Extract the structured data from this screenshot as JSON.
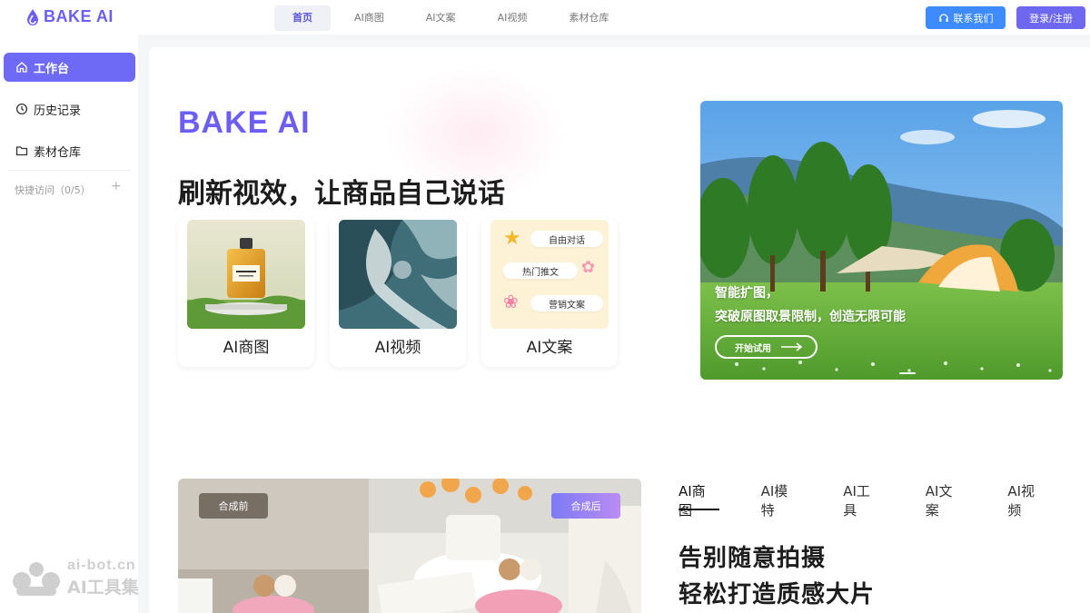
{
  "header": {
    "logo_text": "BAKE AI",
    "nav": [
      {
        "label": "首页",
        "active": true
      },
      {
        "label": "AI商图",
        "active": false
      },
      {
        "label": "AI文案",
        "active": false
      },
      {
        "label": "AI视频",
        "active": false
      },
      {
        "label": "素材仓库",
        "active": false
      }
    ],
    "contact_label": "联系我们",
    "login_label": "登录/注册"
  },
  "sidebar": {
    "items": [
      {
        "label": "工作台",
        "icon": "home-icon",
        "active": true
      },
      {
        "label": "历史记录",
        "icon": "clock-icon",
        "active": false
      },
      {
        "label": "素材仓库",
        "icon": "folder-icon",
        "active": false
      }
    ],
    "quick_access": "快捷访问（0/5）"
  },
  "hero": {
    "brand": "BAKE AI",
    "headline": "刷新视效，让商品自己说话",
    "cards": [
      {
        "label": "AI商图"
      },
      {
        "label": "AI视频"
      },
      {
        "label": "AI文案"
      }
    ],
    "copy_pills": [
      "自由对话",
      "热门推文",
      "营销文案"
    ]
  },
  "banner": {
    "line1": "智能扩图，",
    "line2": "突破原图取景限制，创造无限可能",
    "button": "开始试用"
  },
  "showcase": {
    "before_label": "合成前",
    "after_label": "合成后",
    "tabs": [
      "AI商图",
      "AI模特",
      "AI工具",
      "AI文案",
      "AI视频"
    ],
    "active_tab": 0,
    "slogan1": "告别随意拍摄",
    "slogan2": "轻松打造质感大片"
  },
  "watermark": {
    "line1": "ai-bot.cn",
    "line2": "AI工具集"
  },
  "colors": {
    "brand": "#6c5ef5",
    "contact_button": "#3d8bff",
    "login_button": "#6e67f0",
    "sidebar_active": "#6e6af5"
  }
}
